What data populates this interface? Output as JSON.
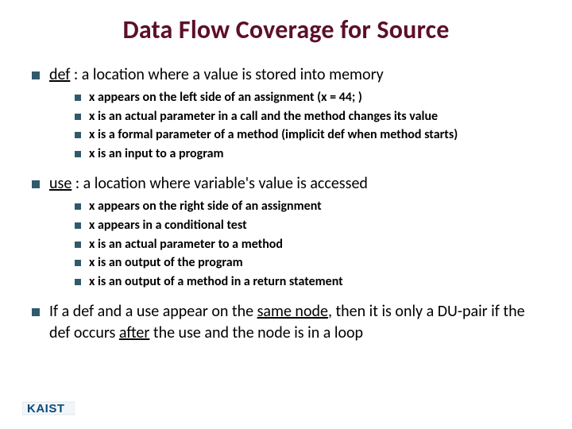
{
  "title": "Data Flow Coverage for Source",
  "items": [
    {
      "term": "def",
      "rest": " : a location where a value is stored into memory",
      "sub": [
        "x appears on the left side of an assignment (x = 44; )",
        "x is an actual parameter in a call and the method changes its value",
        "x is a formal parameter of a method (implicit def when method starts)",
        "x is an input to a program"
      ]
    },
    {
      "term": "use",
      "rest": " : a location where variable's value is accessed",
      "sub": [
        "x appears on the right side of an assignment",
        "x appears in a conditional test",
        "x is an actual parameter to a method",
        "x is an output of the program",
        "x is an output of a method in a return statement"
      ]
    },
    {
      "para_pre": "If a def and a use appear on the ",
      "para_u1": "same node",
      "para_mid1": ", then it is only a DU-pair if the def occurs ",
      "para_u2": "after",
      "para_mid2": " the use and the node is in a loop"
    }
  ],
  "logo": "KAIST"
}
